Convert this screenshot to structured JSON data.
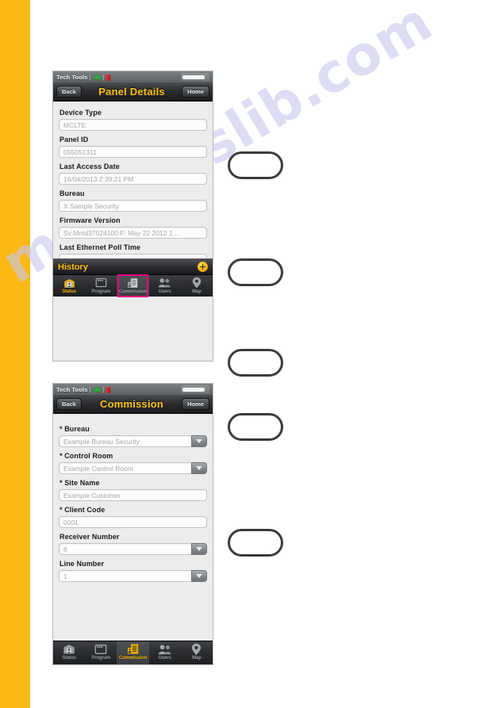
{
  "page": {
    "accent_yellow": "#fcb813",
    "watermark_text": "manualslib.com",
    "watermark_color": "#c9c9ee",
    "highlight_color": "#e5007e"
  },
  "status_bar": {
    "app_label": "Tech Tools",
    "separator": "|",
    "cloud_icon": "cloud-icon",
    "battery_icon": "battery-icon",
    "signal_indicator": "battery-level-indicator"
  },
  "screens": [
    {
      "id": "panel-details",
      "nav": {
        "back_label": "Back",
        "title": "Panel Details",
        "home_label": "Home"
      },
      "fields": [
        {
          "label": "Device Type",
          "value": "MCLTE",
          "type": "text"
        },
        {
          "label": "Panel ID",
          "value": "055051311",
          "type": "text"
        },
        {
          "label": "Last Access Date",
          "value": "16/04/2013 2:39:21 PM",
          "type": "text"
        },
        {
          "label": "Bureau",
          "value": "X Sample Security",
          "type": "text"
        },
        {
          "label": "Firmware Version",
          "value": "Sv:Mntd37024100:F: May 22 2012 1…",
          "type": "text"
        },
        {
          "label": "Last Ethernet Poll Time",
          "value": "",
          "type": "text"
        }
      ],
      "section": {
        "title": "History",
        "add_icon": "plus-circle-icon"
      },
      "tabs": [
        {
          "label": "Status",
          "icon": "status-icon",
          "state": "active"
        },
        {
          "label": "Program",
          "icon": "program-icon",
          "state": "normal"
        },
        {
          "label": "Commission",
          "icon": "commission-icon",
          "state": "selected"
        },
        {
          "label": "Users",
          "icon": "users-icon",
          "state": "normal"
        },
        {
          "label": "Map",
          "icon": "map-pin-icon",
          "state": "normal"
        }
      ]
    },
    {
      "id": "commission",
      "nav": {
        "back_label": "Back",
        "title": "Commission",
        "home_label": "Home"
      },
      "fields": [
        {
          "label": "* Bureau",
          "value": "Example Bureau Security",
          "type": "dropdown"
        },
        {
          "label": "* Control Room",
          "value": "Example Control Room",
          "type": "dropdown"
        },
        {
          "label": "* Site Name",
          "value": "Example Customer",
          "type": "text"
        },
        {
          "label": "* Client Code",
          "value": "0001",
          "type": "text"
        },
        {
          "label": "Receiver Number",
          "value": "8",
          "type": "dropdown"
        },
        {
          "label": "Line Number",
          "value": "1",
          "type": "dropdown"
        }
      ],
      "tabs": [
        {
          "label": "Status",
          "icon": "status-icon",
          "state": "normal"
        },
        {
          "label": "Program",
          "icon": "program-icon",
          "state": "normal"
        },
        {
          "label": "Commission",
          "icon": "commission-icon",
          "state": "active"
        },
        {
          "label": "Users",
          "icon": "users-icon",
          "state": "normal"
        },
        {
          "label": "Map",
          "icon": "map-pin-icon",
          "state": "normal"
        }
      ]
    }
  ],
  "callouts": [
    {
      "name": "callout-1",
      "label": ""
    },
    {
      "name": "callout-2",
      "label": ""
    },
    {
      "name": "callout-3",
      "label": ""
    },
    {
      "name": "callout-4",
      "label": ""
    },
    {
      "name": "callout-5",
      "label": ""
    }
  ]
}
